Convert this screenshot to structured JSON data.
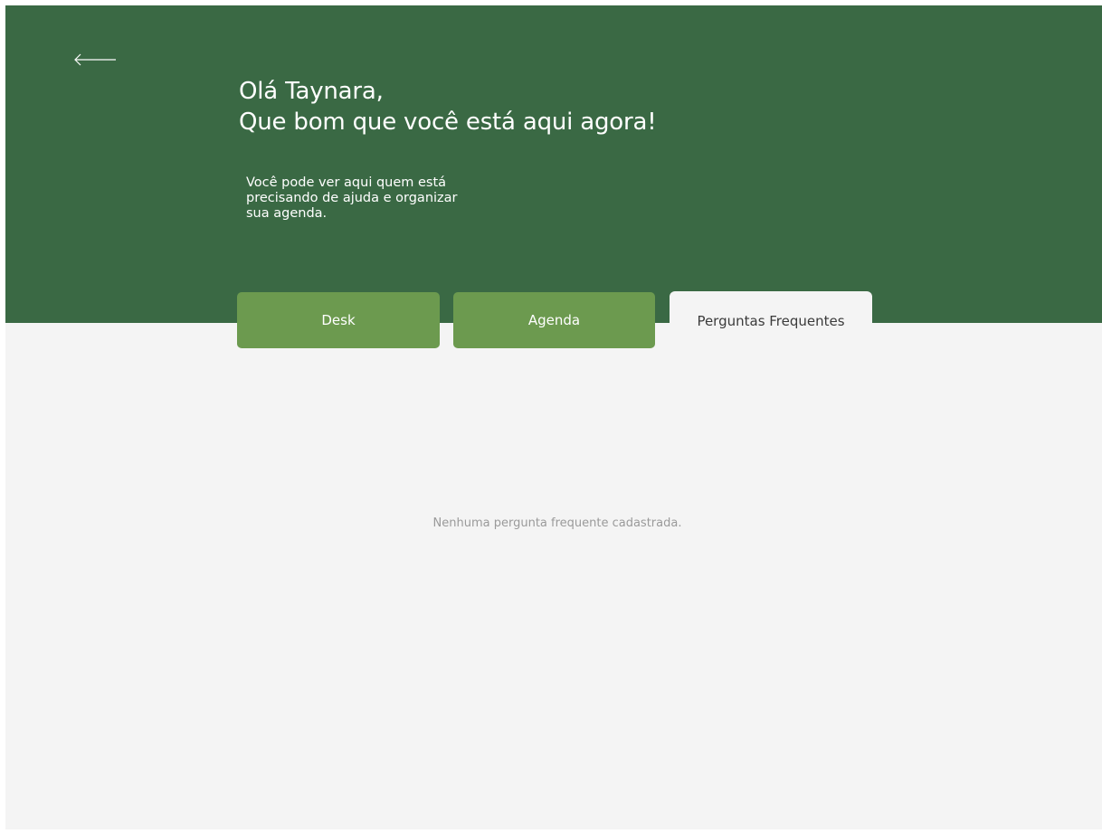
{
  "colors": {
    "header_green": "#3a6944",
    "tab_green": "#6c9a4f",
    "content_bg": "#f4f4f4",
    "active_tab_bg": "#f4f4f4"
  },
  "header": {
    "back_icon": "arrow-left-icon",
    "greeting_line1": "Olá Taynara,",
    "greeting_line2": "Que bom que você está aqui agora!",
    "intro_text": "Você pode ver aqui quem está\nprecisando de ajuda  e organizar\nsua agenda."
  },
  "tabs": [
    {
      "label": "Desk",
      "active": false
    },
    {
      "label": "Agenda",
      "active": false
    },
    {
      "label": "Perguntas Frequentes",
      "active": true
    }
  ],
  "faq": {
    "empty_message": "Nenhuma pergunta frequente cadastrada."
  }
}
